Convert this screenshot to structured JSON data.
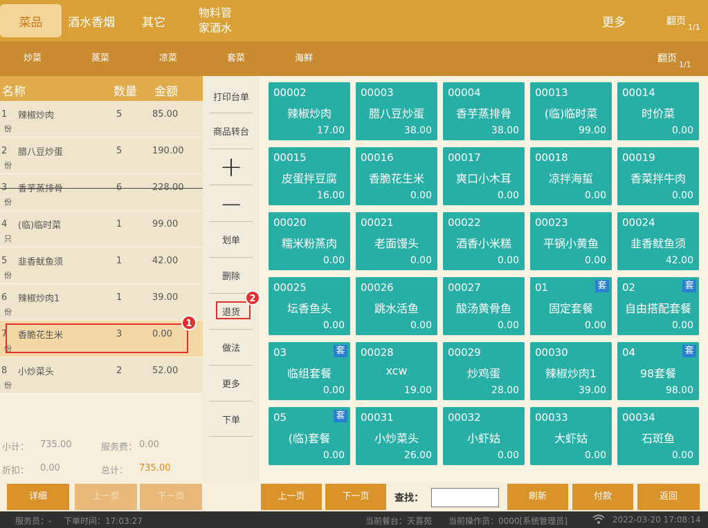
{
  "top_categories": [
    {
      "label": "菜品",
      "active": true
    },
    {
      "label": "酒水香烟",
      "active": false
    },
    {
      "label": "其它",
      "active": false
    },
    {
      "label": "物料管家酒水",
      "line1": "物料管",
      "line2": "家酒水",
      "active": false
    }
  ],
  "top_more": "更多",
  "top_pager": {
    "label": "翻页",
    "fraction": "1/1"
  },
  "sub_categories": [
    "炒菜",
    "蒸菜",
    "凉菜",
    "套菜",
    "海鲜"
  ],
  "sub_pager": {
    "label": "翻页",
    "fraction": "1/1"
  },
  "order_header": {
    "name": "名称",
    "qty": "数量",
    "amount": "金额"
  },
  "order_items": [
    {
      "idx": "1",
      "unit": "份",
      "name": "辣椒炒肉",
      "qty": "5",
      "amount": "85.00",
      "struck": false,
      "selected": false
    },
    {
      "idx": "2",
      "unit": "份",
      "name": "腊八豆炒蛋",
      "qty": "5",
      "amount": "190.00",
      "struck": false,
      "selected": false
    },
    {
      "idx": "3",
      "unit": "份",
      "name": "香芋蒸排骨",
      "qty": "6",
      "amount": "228.00",
      "struck": true,
      "selected": false
    },
    {
      "idx": "4",
      "unit": "只",
      "name": "(临)临时菜",
      "qty": "1",
      "amount": "99.00",
      "struck": false,
      "selected": false
    },
    {
      "idx": "5",
      "unit": "份",
      "name": "韭香鱿鱼须",
      "qty": "1",
      "amount": "42.00",
      "struck": false,
      "selected": false
    },
    {
      "idx": "6",
      "unit": "份",
      "name": "辣椒炒肉1",
      "qty": "1",
      "amount": "39.00",
      "struck": false,
      "selected": false
    },
    {
      "idx": "7",
      "unit": "份",
      "name": "香脆花生米",
      "qty": "3",
      "amount": "0.00",
      "struck": false,
      "selected": true
    },
    {
      "idx": "8",
      "unit": "份",
      "name": "小炒菜头",
      "qty": "2",
      "amount": "52.00",
      "struck": false,
      "selected": false
    }
  ],
  "annotations": {
    "badge1": "1",
    "badge2": "2"
  },
  "totals": {
    "subtotal_label": "小计：",
    "subtotal": "735.00",
    "service_label": "服务费：",
    "service": "0.00",
    "discount_label": "折扣：",
    "discount": "0.00",
    "total_label": "总计：",
    "total": "735.00"
  },
  "left_buttons": {
    "detail": "详细",
    "prev": "上一页",
    "next": "下一页"
  },
  "actions": [
    "打印台单",
    "商品转台",
    "+",
    "−",
    "划单",
    "删除",
    "退货",
    "做法",
    "更多",
    "下单"
  ],
  "dishes": [
    {
      "code": "00002",
      "name": "辣椒炒肉",
      "price": "17.00",
      "set": false
    },
    {
      "code": "00003",
      "name": "腊八豆炒蛋",
      "price": "38.00",
      "set": false
    },
    {
      "code": "00004",
      "name": "香芋蒸排骨",
      "price": "38.00",
      "set": false
    },
    {
      "code": "00013",
      "name": "(临)临时菜",
      "price": "99.00",
      "set": false
    },
    {
      "code": "00014",
      "name": "时价菜",
      "price": "0.00",
      "set": false
    },
    {
      "code": "00015",
      "name": "皮蛋拌豆腐",
      "price": "16.00",
      "set": false
    },
    {
      "code": "00016",
      "name": "香脆花生米",
      "price": "0.00",
      "set": false
    },
    {
      "code": "00017",
      "name": "爽口小木耳",
      "price": "0.00",
      "set": false
    },
    {
      "code": "00018",
      "name": "凉拌海蜇",
      "price": "0.00",
      "set": false
    },
    {
      "code": "00019",
      "name": "香菜拌牛肉",
      "price": "0.00",
      "set": false
    },
    {
      "code": "00020",
      "name": "糯米粉蒸肉",
      "price": "0.00",
      "set": false
    },
    {
      "code": "00021",
      "name": "老面馒头",
      "price": "0.00",
      "set": false
    },
    {
      "code": "00022",
      "name": "酒香小米糕",
      "price": "0.00",
      "set": false
    },
    {
      "code": "00023",
      "name": "平锅小黄鱼",
      "price": "0.00",
      "set": false
    },
    {
      "code": "00024",
      "name": "韭香鱿鱼须",
      "price": "42.00",
      "set": false
    },
    {
      "code": "00025",
      "name": "坛香鱼头",
      "price": "0.00",
      "set": false
    },
    {
      "code": "00026",
      "name": "跳水活鱼",
      "price": "0.00",
      "set": false
    },
    {
      "code": "00027",
      "name": "酸汤黄骨鱼",
      "price": "0.00",
      "set": false
    },
    {
      "code": "01",
      "name": "固定套餐",
      "price": "0.00",
      "set": true
    },
    {
      "code": "02",
      "name": "自由搭配套餐",
      "price": "0.00",
      "set": true
    },
    {
      "code": "03",
      "name": "临组套餐",
      "price": "0.00",
      "set": true
    },
    {
      "code": "00028",
      "name": "xcw",
      "price": "19.00",
      "set": false
    },
    {
      "code": "00029",
      "name": "炒鸡蛋",
      "price": "28.00",
      "set": false
    },
    {
      "code": "00030",
      "name": "辣椒炒肉1",
      "price": "39.00",
      "set": false
    },
    {
      "code": "04",
      "name": "98套餐",
      "price": "98.00",
      "set": true
    },
    {
      "code": "05",
      "name": "(临)套餐",
      "price": "0.00",
      "set": true
    },
    {
      "code": "00031",
      "name": "小炒菜头",
      "price": "26.00",
      "set": false
    },
    {
      "code": "00032",
      "name": "小虾姑",
      "price": "0.00",
      "set": false
    },
    {
      "code": "00033",
      "name": "大虾姑",
      "price": "0.00",
      "set": false
    },
    {
      "code": "00034",
      "name": "石斑鱼",
      "price": "0.00",
      "set": false
    }
  ],
  "set_tag": "套",
  "grid_buttons": {
    "prev": "上一页",
    "next": "下一页",
    "refresh": "刷新",
    "pay": "付款",
    "back": "返回"
  },
  "search": {
    "label": "查找：",
    "value": ""
  },
  "status_bar": {
    "waiter": "服务员：-",
    "order_time": "下单时间：17:03:27",
    "table": "当前餐台：天喜苑",
    "operator": "当前操作员：0000[系统管理员]",
    "datetime": "2022-03-20 17:08:14"
  }
}
